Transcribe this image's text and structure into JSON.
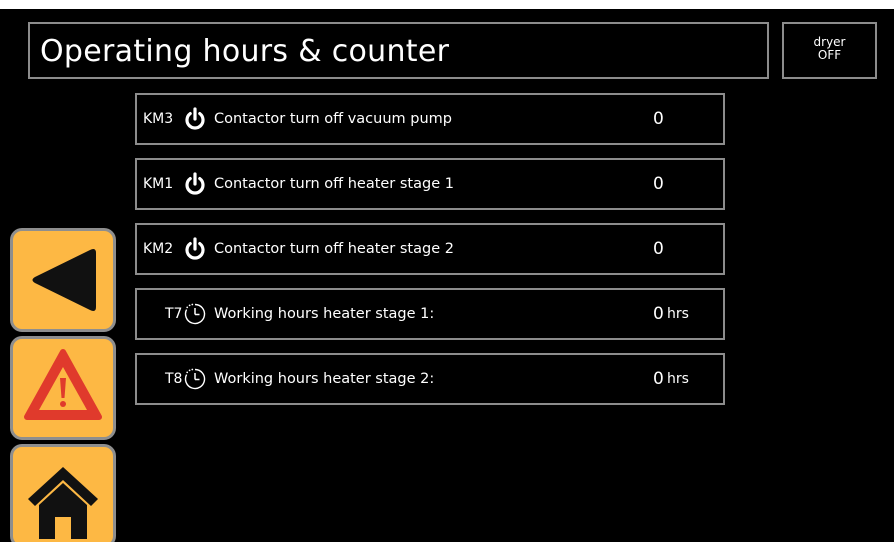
{
  "header": {
    "title": "Operating hours & counter",
    "status_line1": "dryer",
    "status_line2": "OFF"
  },
  "rows": [
    {
      "tag": "KM3",
      "icon": "power-icon",
      "label": "Contactor turn off vacuum pump",
      "value": "0",
      "unit": ""
    },
    {
      "tag": "KM1",
      "icon": "power-icon",
      "label": "Contactor turn off heater stage 1",
      "value": "0",
      "unit": ""
    },
    {
      "tag": "KM2",
      "icon": "power-icon",
      "label": "Contactor turn off heater stage 2",
      "value": "0",
      "unit": ""
    },
    {
      "tag": "T7",
      "icon": "clock-icon",
      "label": "Working hours heater stage 1:",
      "value": "0",
      "unit": "hrs"
    },
    {
      "tag": "T8",
      "icon": "clock-icon",
      "label": "Working hours heater stage 2:",
      "value": "0",
      "unit": "hrs"
    }
  ],
  "nav": [
    {
      "name": "back",
      "icon": "back-arrow-icon"
    },
    {
      "name": "alarm",
      "icon": "warning-icon"
    },
    {
      "name": "home",
      "icon": "home-icon"
    }
  ],
  "colors": {
    "background": "#000000",
    "border": "#8c8c8c",
    "button": "#fdb844",
    "warning": "#e03a2c"
  }
}
